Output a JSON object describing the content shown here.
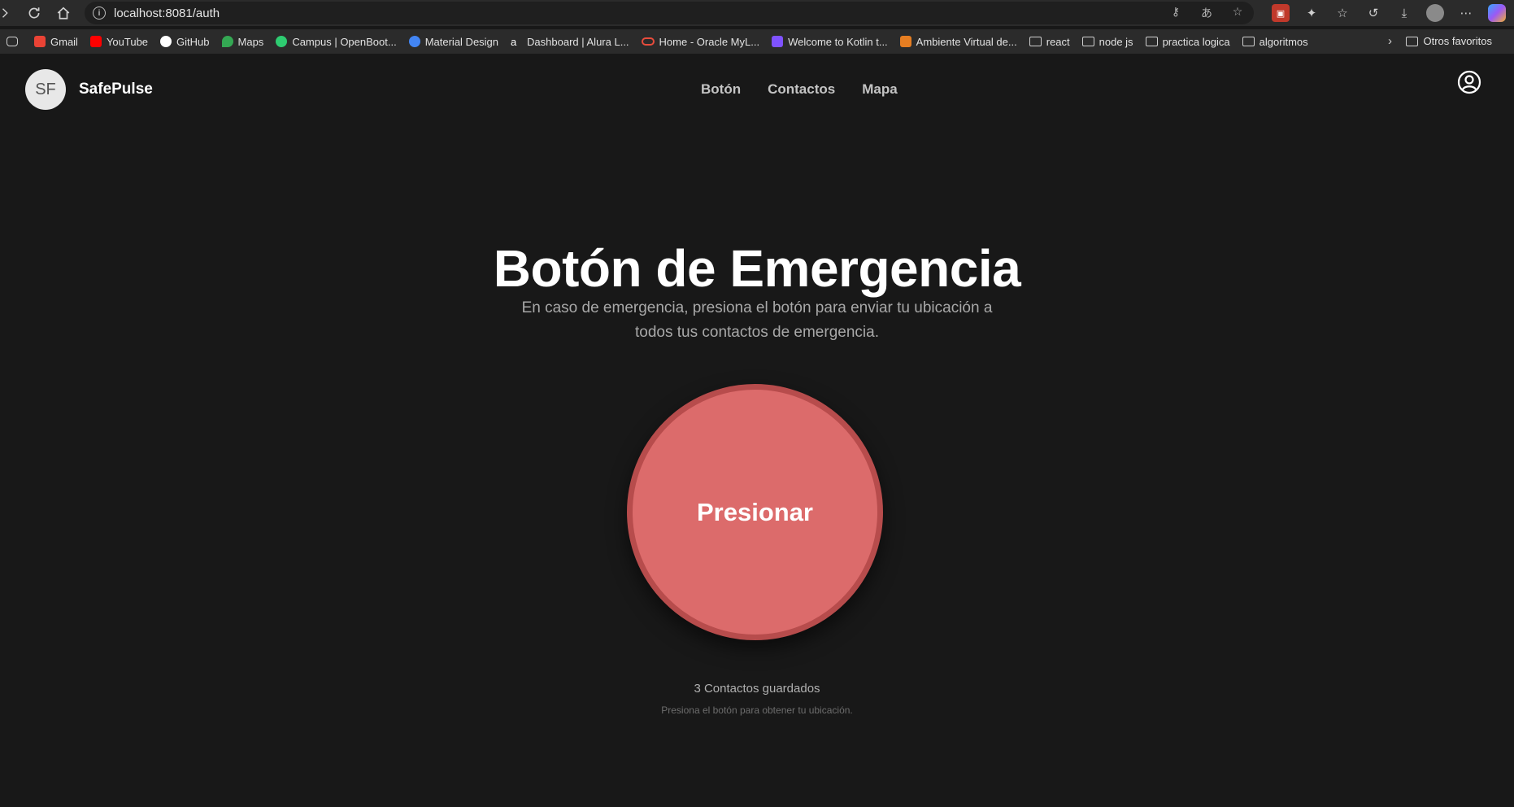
{
  "browser": {
    "url": "localhost:8081/auth",
    "bookmarks": [
      {
        "label": "Gmail",
        "color": "#ea4335"
      },
      {
        "label": "YouTube",
        "color": "#ff0000"
      },
      {
        "label": "GitHub",
        "color": "#ffffff"
      },
      {
        "label": "Maps",
        "color": "#34a853"
      },
      {
        "label": "Campus | OpenBoot...",
        "color": "#2ecc71"
      },
      {
        "label": "Material Design",
        "color": "#4285f4"
      },
      {
        "label": "Dashboard | Alura L...",
        "color": "#ffffff"
      },
      {
        "label": "Home - Oracle MyL...",
        "color": "#e74c3c"
      },
      {
        "label": "Welcome to Kotlin t...",
        "color": "#7f52ff"
      },
      {
        "label": "Ambiente Virtual de...",
        "color": "#e67e22"
      },
      {
        "label": "react",
        "folder": true
      },
      {
        "label": "node js",
        "folder": true
      },
      {
        "label": "practica logica",
        "folder": true
      },
      {
        "label": "algoritmos",
        "folder": true
      }
    ],
    "other_bookmarks": "Otros favoritos"
  },
  "app": {
    "avatar_initials": "SF",
    "brand": "SafePulse",
    "nav": {
      "boton": "Botón",
      "contactos": "Contactos",
      "mapa": "Mapa"
    }
  },
  "hero": {
    "title": "Botón de Emergencia",
    "subtitle": "En caso de emergencia, presiona el botón para enviar tu ubicación a todos tus contactos de emergencia.",
    "button_label": "Presionar"
  },
  "status": {
    "contacts": "3 Contactos guardados",
    "hint": "Presiona el botón para obtener tu ubicación."
  },
  "colors": {
    "background": "#181818",
    "emergency": "#dc6b6b",
    "emergency_border": "#b74c4c"
  }
}
